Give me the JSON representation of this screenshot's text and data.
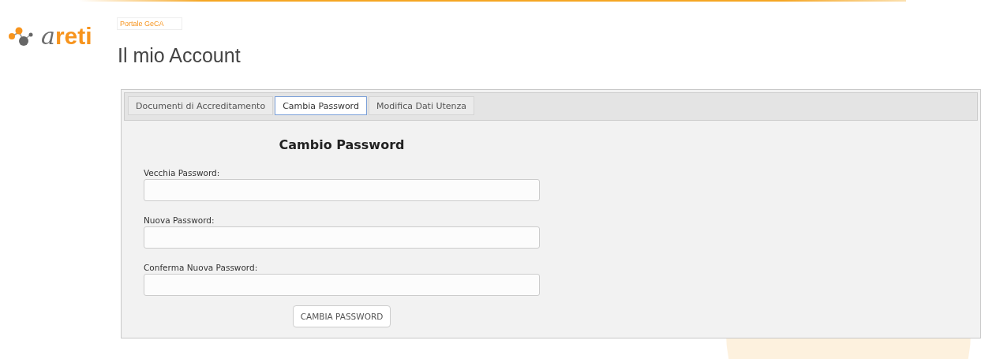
{
  "logo": {
    "prefix": "a",
    "name": "reti"
  },
  "breadcrumb": "Portale GeCA",
  "page_title": "Il mio Account",
  "tabs": [
    {
      "label": "Documenti di Accreditamento",
      "selected": false
    },
    {
      "label": "Cambia Password",
      "selected": true
    },
    {
      "label": "Modifica Dati Utenza",
      "selected": false
    }
  ],
  "form": {
    "title": "Cambio Password",
    "fields": [
      {
        "label": "Vecchia Password:"
      },
      {
        "label": "Nuova Password:"
      },
      {
        "label": "Conferma Nuova Password:"
      }
    ],
    "submit": "CAMBIA PASSWORD"
  }
}
